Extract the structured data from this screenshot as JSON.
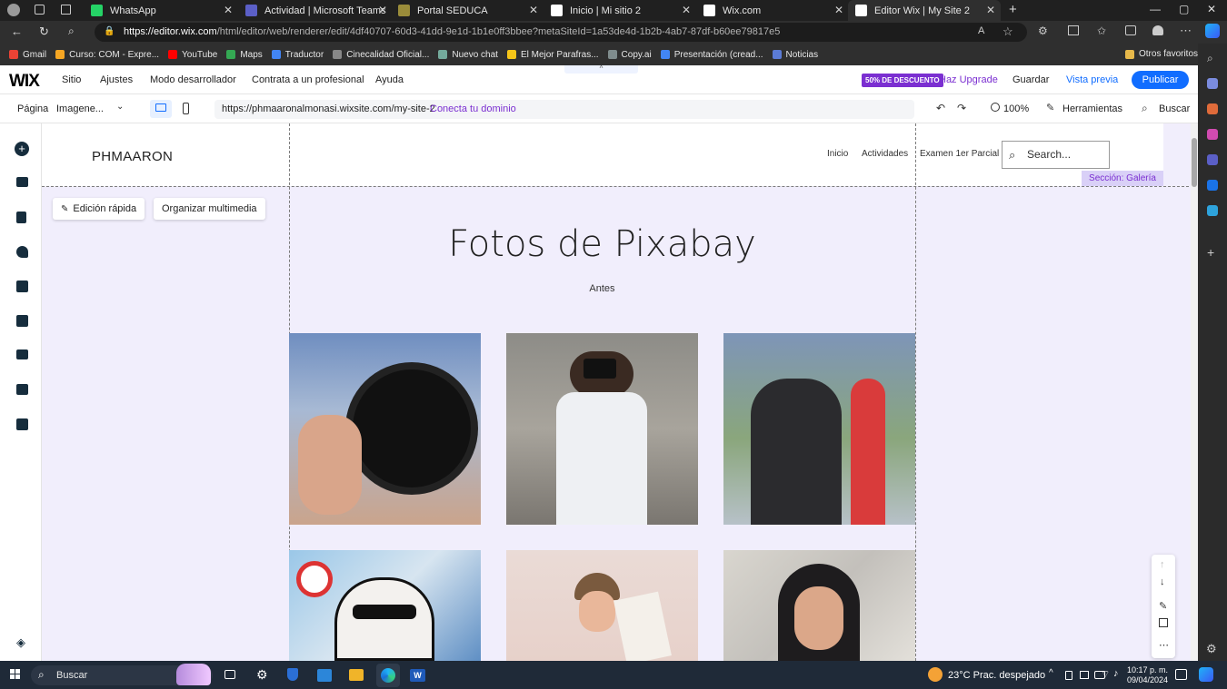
{
  "browser": {
    "tabs": [
      {
        "title": "WhatsApp",
        "icon": "whatsapp-icon",
        "color": "#25d366"
      },
      {
        "title": "Actividad | Microsoft Teams",
        "icon": "teams-icon",
        "color": "#5b5fc7"
      },
      {
        "title": "Portal SEDUCA",
        "icon": "seduca-icon",
        "color": "#9a8c3a"
      },
      {
        "title": "Inicio | Mi sitio 2",
        "icon": "wix-icon",
        "color": "#ffffff"
      },
      {
        "title": "Wix.com",
        "icon": "wix-icon",
        "color": "#ffffff"
      },
      {
        "title": "Editor Wix | My Site 2",
        "icon": "wix-icon",
        "color": "#ffffff"
      }
    ],
    "url_host": "https://editor.wix.com",
    "url_path": "/html/editor/web/renderer/edit/4df40707-60d3-41dd-9e1d-1b1e0ff3bbee?metaSiteId=1a53de4d-1b2b-4ab7-87df-b60ee79817e5",
    "bookmarks": [
      {
        "label": "Gmail",
        "color": "#ea4335"
      },
      {
        "label": "Curso: COM - Expre...",
        "color": "#f5a623"
      },
      {
        "label": "YouTube",
        "color": "#ff0000"
      },
      {
        "label": "Maps",
        "color": "#34a853"
      },
      {
        "label": "Traductor",
        "color": "#4285f4"
      },
      {
        "label": "Cinecalidad Oficial...",
        "color": "#888888"
      },
      {
        "label": "Nuevo chat",
        "color": "#74aa9c"
      },
      {
        "label": "El Mejor Parafras...",
        "color": "#f5c518"
      },
      {
        "label": "Copy.ai",
        "color": "#7f8c8d"
      },
      {
        "label": "Presentación (cread...",
        "color": "#4285f4"
      },
      {
        "label": "Noticias",
        "color": "#5b7bd5"
      }
    ],
    "other_bookmarks": "Otros favoritos"
  },
  "wix": {
    "logo": "WIX",
    "menu": [
      "Sitio",
      "Ajustes",
      "Modo desarrollador",
      "Contrata a un profesional",
      "Ayuda"
    ],
    "discount_badge": "50% DE DESCUENTO",
    "upgrade": "Haz Upgrade",
    "save": "Guardar",
    "preview": "Vista previa",
    "publish": "Publicar",
    "page_label": "Página",
    "page_value": "Imagene...",
    "site_url": "https://phmaaronalmonasi.wixsite.com/my-site-2",
    "connect_domain": "Conecta tu dominio",
    "zoom": "100%",
    "tools": "Herramientas",
    "search": "Buscar"
  },
  "site": {
    "name": "PHMAARON",
    "nav": [
      "Inicio",
      "Actividades",
      "Examen 1er Parcial"
    ],
    "search_placeholder": "Search...",
    "section_label": "Sección: Galería",
    "quick_edit": "Edición rápida",
    "organize_media": "Organizar multimedia",
    "gallery_title": "Fotos de Pixabay",
    "gallery_subtitle": "Antes"
  },
  "taskbar": {
    "search": "Buscar",
    "weather": "23°C  Prac. despejado",
    "time": "10:17 p. m.",
    "date": "09/04/2024"
  }
}
